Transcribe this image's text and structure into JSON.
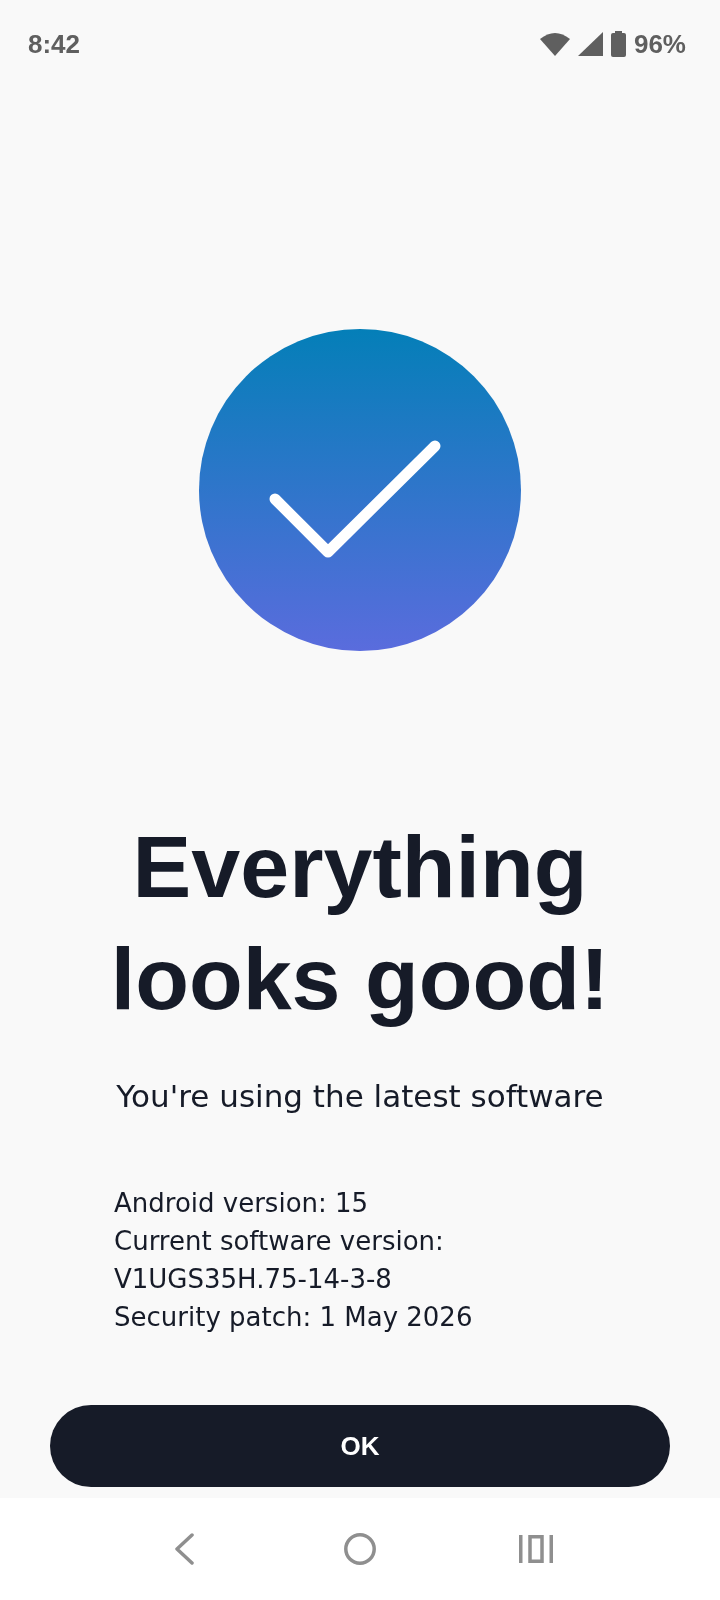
{
  "status_bar": {
    "time": "8:42",
    "battery": "96%"
  },
  "result": {
    "title": "Everything looks good!",
    "subtitle": "You're using the latest software"
  },
  "details": [
    "Android version: 15",
    "Current software version: V1UGS35H.75-14-3-8",
    "Security patch: 1 May 2026"
  ],
  "ok_button": {
    "label": "OK"
  }
}
